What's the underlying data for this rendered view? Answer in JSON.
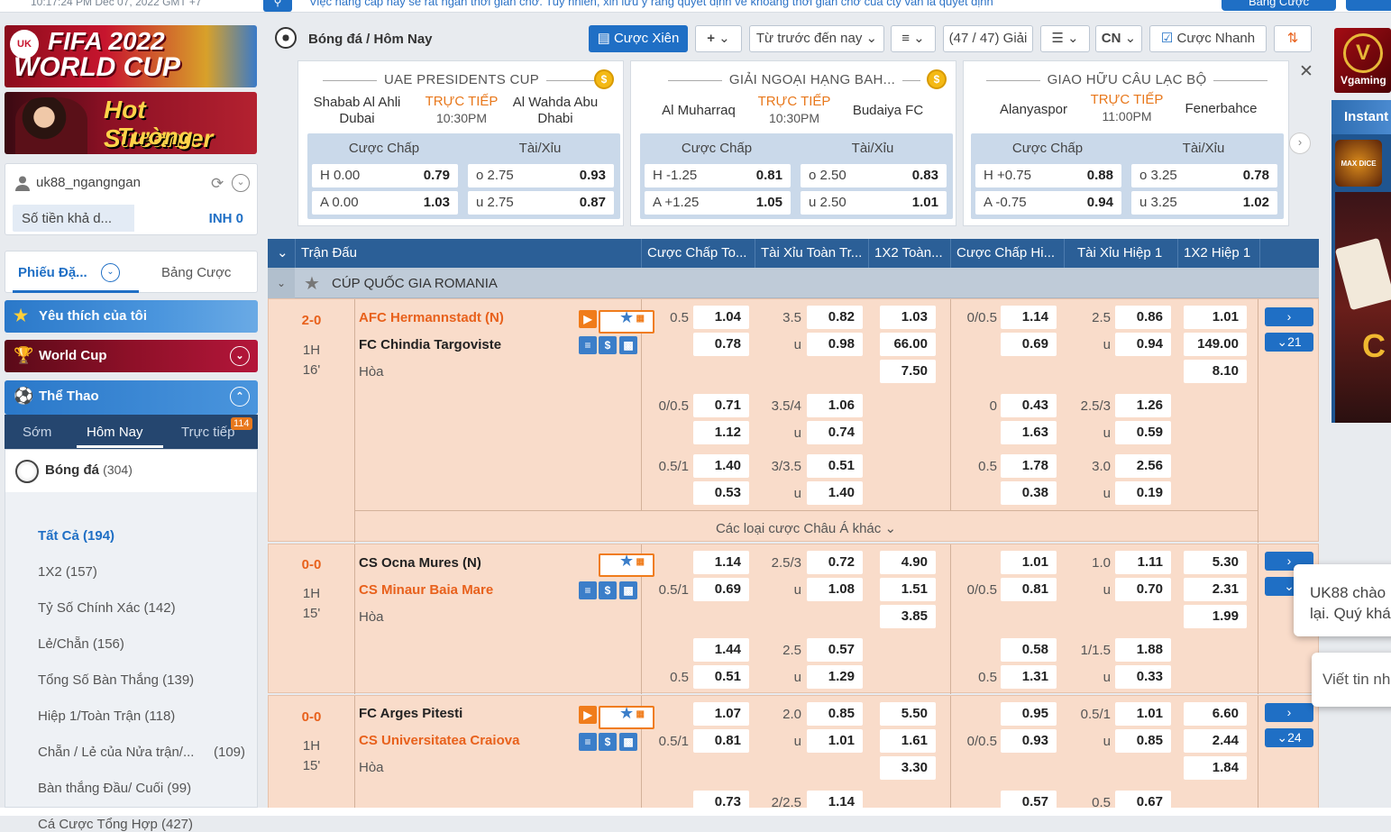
{
  "topbar": {
    "clock": "10:17:24 PM Dec 07, 2022 GMT +7",
    "marquee": "Việc nâng cấp này sẽ rất ngắn thời gian chờ. Tuy nhiên, xin lưu ý rằng quyết định về khoảng thời gian chờ của cty vẫn là quyết định",
    "account_btn": "Bảng Cược"
  },
  "banners": {
    "b1_line1": "FIFA 2022",
    "b1_line2": "WORLD CUP",
    "b2_line1": "Hot Streamer",
    "b2_line2": "Tường Thuật"
  },
  "user": {
    "name": "uk88_ngangngan",
    "balance_label": "Số tiền khả d...",
    "balance_value": "INH 0"
  },
  "bet_tabs": {
    "slip": "Phiếu Đặ...",
    "list": "Bảng Cược"
  },
  "menu": {
    "favorites": "Yêu thích của tôi",
    "worldcup": "World Cup",
    "sports": "Thể Thao"
  },
  "sport_tabs": {
    "early": "Sớm",
    "today": "Hôm Nay",
    "live": "Trực tiếp",
    "live_count": "114"
  },
  "sport": {
    "name": "Bóng đá",
    "count": "(304)"
  },
  "bet_types": [
    "Tất Cả (194)",
    "1X2 (157)",
    "Tỷ Số Chính Xác (142)",
    "Lẻ/Chẵn (156)",
    "Tổng Số Bàn Thắng (139)",
    "Hiệp 1/Toàn Trận (118)",
    "Chẵn / Lẻ của Nửa trận/...",
    "Bàn thắng Đầu/ Cuối (99)",
    "Cá Cược Tổng Hợp (427)"
  ],
  "bet_type_extra": "(109)",
  "header": {
    "breadcrumb": "Bóng đá / Hôm Nay",
    "parlay": "Cược Xiên",
    "plus": "+",
    "sort": "Từ trước đến nay",
    "count": "(47 / 47) Giải",
    "lang": "CN",
    "quick": "Cược Nhanh"
  },
  "featured": [
    {
      "league": "UAE PRESIDENTS CUP",
      "home": "Shabab Al Ahli Dubai",
      "away": "Al Wahda Abu Dhabi",
      "status": "TRỰC TIẾP",
      "time": "10:30PM",
      "hdp_label": "Cược Chấp",
      "ou_label": "Tài/Xỉu",
      "h_line": "H 0.00",
      "h_odds": "0.79",
      "a_line": "A 0.00",
      "a_odds": "1.03",
      "o_line": "o 2.75",
      "o_odds": "0.93",
      "u_line": "u 2.75",
      "u_odds": "0.87"
    },
    {
      "league": "GIẢI NGOẠI HẠNG BAH...",
      "home": "Al Muharraq",
      "away": "Budaiya FC",
      "status": "TRỰC TIẾP",
      "time": "10:30PM",
      "hdp_label": "Cược Chấp",
      "ou_label": "Tài/Xỉu",
      "h_line": "H -1.25",
      "h_odds": "0.81",
      "a_line": "A +1.25",
      "a_odds": "1.05",
      "o_line": "o 2.50",
      "o_odds": "0.83",
      "u_line": "u 2.50",
      "u_odds": "1.01"
    },
    {
      "league": "GIAO HỮU CÂU LẠC BỘ",
      "home": "Alanyaspor",
      "away": "Fenerbahce",
      "status": "TRỰC TIẾP",
      "time": "11:00PM",
      "hdp_label": "Cược Chấp",
      "ou_label": "Tài/Xỉu",
      "h_line": "H +0.75",
      "h_odds": "0.88",
      "a_line": "A -0.75",
      "a_odds": "0.94",
      "o_line": "o 3.25",
      "o_odds": "0.78",
      "u_line": "u 3.25",
      "u_odds": "1.02"
    }
  ],
  "table_head": [
    "Trận Đấu",
    "Cược Chấp To...",
    "Tài Xỉu Toàn Tr...",
    "1X2 Toàn...",
    "Cược Chấp Hi...",
    "Tài Xỉu Hiệp 1",
    "1X2 Hiệp 1"
  ],
  "league": "CÚP QUỐC GIA ROMANIA",
  "draw_label": "Hòa",
  "other_bets": "Các loại cược Châu Á khác",
  "matches": [
    {
      "score": "2-0",
      "half": "1H",
      "minute": "16'",
      "home": "AFC Hermannstadt (N)",
      "away": "FC Chindia Targoviste",
      "more": "21",
      "r1": {
        "hc": "0.5",
        "ho": "1.04",
        "ouh": "3.5",
        "ouo": "0.82",
        "x1": "1.03",
        "hhc": "0/0.5",
        "hho": "1.14",
        "h1ouh": "2.5",
        "h1ouo": "0.86",
        "h1x": "1.01"
      },
      "r2": {
        "hc": "",
        "ho": "0.78",
        "ouh": "u",
        "ouo": "0.98",
        "x1": "66.00",
        "hhc": "",
        "hho": "0.69",
        "h1ouh": "u",
        "h1ouo": "0.94",
        "h1x": "149.00"
      },
      "r3": {
        "x1": "7.50",
        "h1x": "8.10"
      },
      "r4": {
        "hc": "0/0.5",
        "ho": "0.71",
        "ouh": "3.5/4",
        "ouo": "1.06",
        "hhc": "0",
        "hho": "0.43",
        "h1ouh": "2.5/3",
        "h1ouo": "1.26"
      },
      "r5": {
        "hc": "",
        "ho": "1.12",
        "ouh": "u",
        "ouo": "0.74",
        "hhc": "",
        "hho": "1.63",
        "h1ouh": "u",
        "h1ouo": "0.59"
      },
      "r6": {
        "hc": "0.5/1",
        "ho": "1.40",
        "ouh": "3/3.5",
        "ouo": "0.51",
        "hhc": "0.5",
        "hho": "1.78",
        "h1ouh": "3.0",
        "h1ouo": "2.56"
      },
      "r7": {
        "hc": "",
        "ho": "0.53",
        "ouh": "u",
        "ouo": "1.40",
        "hhc": "",
        "hho": "0.38",
        "h1ouh": "u",
        "h1ouo": "0.19"
      }
    },
    {
      "score": "0-0",
      "half": "1H",
      "minute": "15'",
      "home": "CS Ocna Mures (N)",
      "away": "CS Minaur Baia Mare",
      "more": "",
      "r1": {
        "hc": "",
        "ho": "1.14",
        "ouh": "2.5/3",
        "ouo": "0.72",
        "x1": "4.90",
        "hhc": "",
        "hho": "1.01",
        "h1ouh": "1.0",
        "h1ouo": "1.11",
        "h1x": "5.30"
      },
      "r2": {
        "hc": "0.5/1",
        "ho": "0.69",
        "ouh": "u",
        "ouo": "1.08",
        "x1": "1.51",
        "hhc": "0/0.5",
        "hho": "0.81",
        "h1ouh": "u",
        "h1ouo": "0.70",
        "h1x": "2.31"
      },
      "r3": {
        "x1": "3.85",
        "h1x": "1.99"
      },
      "r4": {
        "hc": "",
        "ho": "1.44",
        "ouh": "2.5",
        "ouo": "0.57",
        "hhc": "",
        "hho": "0.58",
        "h1ouh": "1/1.5",
        "h1ouo": "1.88"
      },
      "r5": {
        "hc": "0.5",
        "ho": "0.51",
        "ouh": "u",
        "ouo": "1.29",
        "hhc": "0.5",
        "hho": "1.31",
        "h1ouh": "u",
        "h1ouo": "0.33"
      }
    },
    {
      "score": "0-0",
      "half": "1H",
      "minute": "15'",
      "home": "FC Arges Pitesti",
      "away": "CS Universitatea Craiova",
      "more": "24",
      "r1": {
        "hc": "",
        "ho": "1.07",
        "ouh": "2.0",
        "ouo": "0.85",
        "x1": "5.50",
        "hhc": "",
        "hho": "0.95",
        "h1ouh": "0.5/1",
        "h1ouo": "1.01",
        "h1x": "6.60"
      },
      "r2": {
        "hc": "0.5/1",
        "ho": "0.81",
        "ouh": "u",
        "ouo": "1.01",
        "x1": "1.61",
        "hhc": "0/0.5",
        "hho": "0.93",
        "h1ouh": "u",
        "h1ouo": "0.85",
        "h1x": "2.44"
      },
      "r3": {
        "x1": "3.30",
        "h1x": "1.84"
      },
      "r4": {
        "hc": "",
        "ho": "0.73",
        "ouh": "2/2.5",
        "ouo": "1.14",
        "hhc": "",
        "hho": "0.57",
        "h1ouh": "0.5",
        "h1ouo": "0.67"
      }
    }
  ],
  "rightbar": {
    "vgaming": "Vgaming",
    "instant": "Instant",
    "game": "MAX DICE"
  },
  "chat": {
    "greet": "UK88 chào",
    "greet2": "lại. Quý khá",
    "input": "Viết tin nh"
  }
}
